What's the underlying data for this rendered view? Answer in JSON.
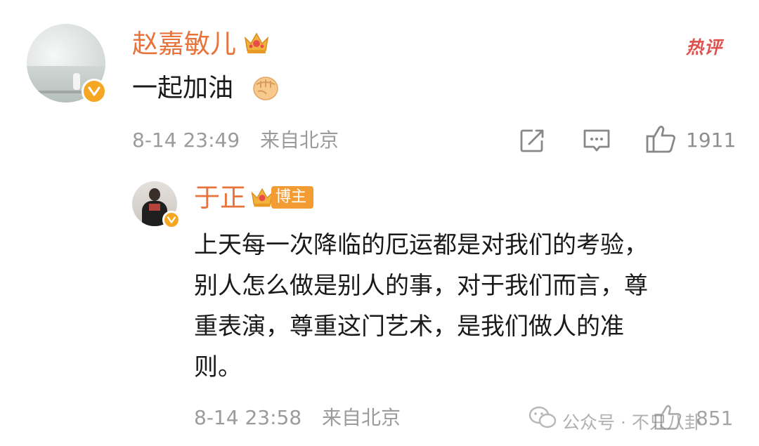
{
  "main_comment": {
    "username": "赵嘉敏儿",
    "text": "一起加油",
    "hot_label": "热评",
    "timestamp": "8-14 23:49",
    "location": "来自北京",
    "like_count": "1911",
    "icons": [
      "crown-icon",
      "fist-emoji-icon",
      "share-icon",
      "comment-icon",
      "like-icon"
    ]
  },
  "reply": {
    "username": "于正",
    "badge": "博主",
    "lines": [
      "上天每一次降临的厄运都是对我们的考验，",
      "别人怎么做是别人的事，对于我们而言，尊",
      "重表演，尊重这门艺术，是我们做人的准",
      "则。"
    ],
    "timestamp": "8-14 23:58",
    "location": "来自北京",
    "like_count": "851"
  },
  "watermark": {
    "text": "公众号 · 不只八卦"
  },
  "colors": {
    "username": "#e8743c",
    "hot": "#e0514d",
    "badge": "#f39c33",
    "meta": "#9b9b9b"
  }
}
